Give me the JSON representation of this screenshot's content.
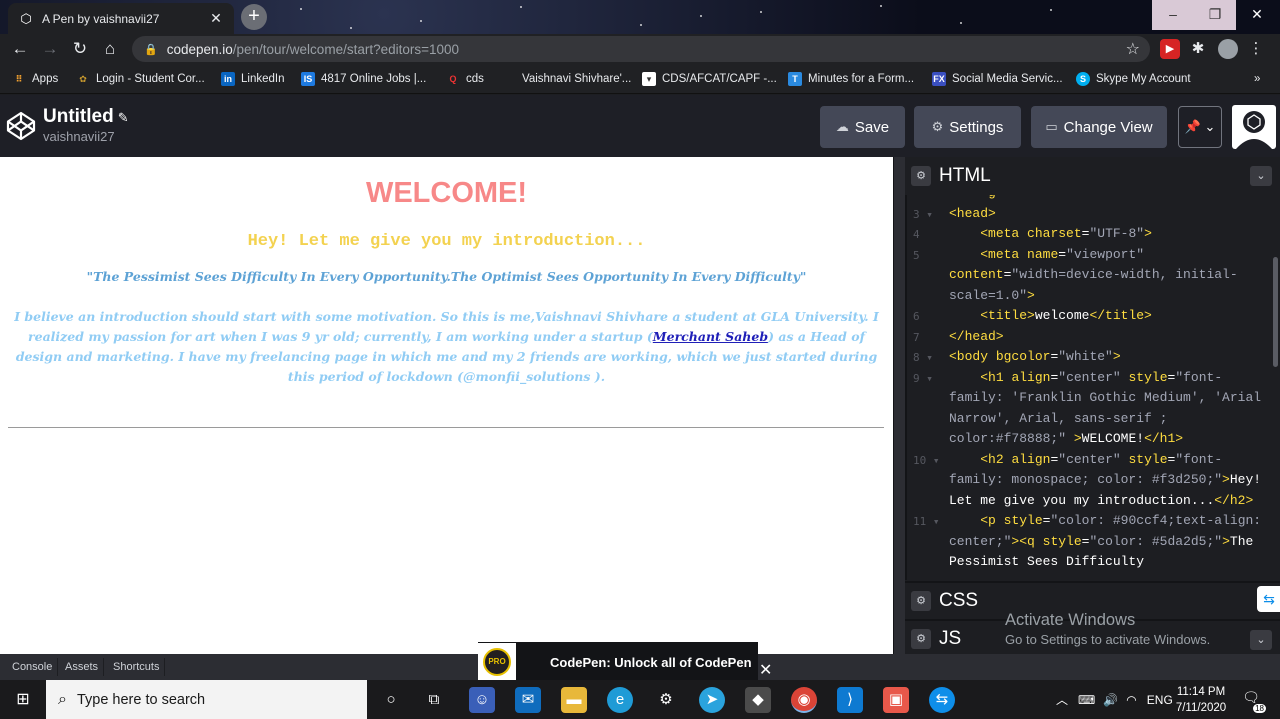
{
  "browser": {
    "tab_title": "A Pen by vaishnavii27",
    "url_host": "codepen.io",
    "url_path": "/pen/tour/welcome/start?editors=1000",
    "bookmarks": [
      "Apps",
      "Login - Student Cor...",
      "LinkedIn",
      "4817 Online Jobs |...",
      "cds",
      "Vaishnavi Shivhare'...",
      "CDS/AFCAT/CAPF -...",
      "Minutes for a Form...",
      "Social Media Servic...",
      "Skype My Account"
    ],
    "bookmarks_overflow": "»"
  },
  "codepen": {
    "pen_title": "Untitled",
    "username": "vaishnavii27",
    "buttons": {
      "save": "Save",
      "settings": "Settings",
      "change_view": "Change View"
    },
    "editors": {
      "html": "HTML",
      "css": "CSS",
      "js": "JS"
    },
    "bottom": {
      "console": "Console",
      "assets": "Assets",
      "shortcuts": "Shortcuts",
      "promo_text": "CodePen: Unlock all of CodePen",
      "promo_badge": "PRO"
    }
  },
  "preview": {
    "h1": "WELCOME!",
    "h2": "Hey! Let me give you my introduction...",
    "quote": "\"The Pessimist Sees Difficulty In Every Opportunity.The Optimist Sees Opportunity In Every Difficulty\"",
    "intro_before": "I believe an introduction should start with some motivation. So this is me,Vaishnavi Shivhare a student at GLA University. I realized my passion for art when I was 9 yr old; currently, I am working under a startup (",
    "intro_link": "Merchant Saheb",
    "intro_after": ") as a Head of design and marketing. I have my freelancing page in which me and my 2 friends are working, which we just started during this period of lockdown (@monfii_solutions )."
  },
  "code_lines": [
    {
      "n": "",
      "html": "<span class='tg'>    &lt;</span><span class='tg'>g</span>"
    },
    {
      "n": "3",
      "html": "<span class='tg'>&lt;head&gt;</span>"
    },
    {
      "n": "4",
      "html": "    <span class='tg'>&lt;meta</span> <span class='at'>charset</span>=<span class='av'>\"UTF-8\"</span><span class='tg'>&gt;</span>"
    },
    {
      "n": "5",
      "html": "    <span class='tg'>&lt;meta</span> <span class='at'>name</span>=<span class='av'>\"viewport\"</span>\n<span class='at'>content</span>=<span class='av'>\"width=device-width, initial-scale=1.0\"</span><span class='tg'>&gt;</span>"
    },
    {
      "n": "6",
      "html": "    <span class='tg'>&lt;title&gt;</span>welcome<span class='tg'>&lt;/title&gt;</span>"
    },
    {
      "n": "7",
      "html": "<span class='tg'>&lt;/head&gt;</span>"
    },
    {
      "n": "8",
      "html": "<span class='tg'>&lt;body</span> <span class='at'>bgcolor</span>=<span class='av'>\"white\"</span><span class='tg'>&gt;</span>"
    },
    {
      "n": "9",
      "html": "    <span class='tg'>&lt;h1</span> <span class='at'>align</span>=<span class='av'>\"center\"</span> <span class='at'>style</span>=<span class='av'>\"font-family: 'Franklin Gothic Medium', 'Arial Narrow', Arial, sans-serif ; color:#f78888;\"</span> <span class='tg'>&gt;</span>WELCOME!<span class='tg'>&lt;/h1&gt;</span>"
    },
    {
      "n": "10",
      "html": "    <span class='tg'>&lt;h2</span> <span class='at'>align</span>=<span class='av'>\"center\"</span> <span class='at'>style</span>=<span class='av'>\"font-family: monospace; color: #f3d250;\"</span><span class='tg'>&gt;</span>Hey! Let me give you my introduction...<span class='tg'>&lt;/h2&gt;</span>"
    },
    {
      "n": "11",
      "html": "    <span class='tg'>&lt;p</span> <span class='at'>style</span>=<span class='av'>\"color: #90ccf4;text-align: center;\"</span><span class='tg'>&gt;&lt;q</span> <span class='at'>style</span>=<span class='av'>\"color: #5da2d5;\"</span><span class='tg'>&gt;</span>The Pessimist Sees Difficulty"
    }
  ],
  "windows": {
    "activate_title": "Activate Windows",
    "activate_sub": "Go to Settings to activate Windows.",
    "search_placeholder": "Type here to search",
    "language": "ENG",
    "time": "11:14 PM",
    "date": "7/11/2020",
    "notification_count": "18"
  },
  "colors": {
    "h1": "#f78888",
    "h2": "#f3d250",
    "quote": "#5da2d5",
    "paragraph": "#90ccf4",
    "codepen_bg": "#1e1f26",
    "code_tag": "#ffdd40"
  }
}
